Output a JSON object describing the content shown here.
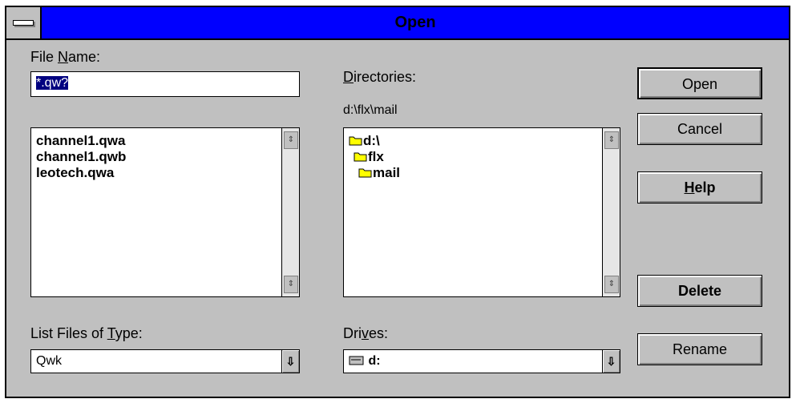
{
  "window": {
    "title": "Open"
  },
  "file_name": {
    "label_pre": "File ",
    "label_accel": "N",
    "label_post": "ame:",
    "value": "*.qw?",
    "files": [
      "channel1.qwa",
      "channel1.qwb",
      "leotech.qwa"
    ]
  },
  "directories": {
    "label_pre": "",
    "label_accel": "D",
    "label_post": "irectories:",
    "current_path": "d:\\flx\\mail",
    "items": [
      {
        "name": "d:\\",
        "icon": "open-folder-icon"
      },
      {
        "name": "flx",
        "icon": "open-folder-icon"
      },
      {
        "name": "mail",
        "icon": "open-folder-icon"
      }
    ]
  },
  "file_type": {
    "label_pre": "List Files of ",
    "label_accel": "T",
    "label_post": "ype:",
    "selected": "Qwk"
  },
  "drives": {
    "label_pre": "Dri",
    "label_accel": "v",
    "label_post": "es:",
    "selected": "d:",
    "icon": "drive-icon"
  },
  "buttons": {
    "open": "Open",
    "cancel": "Cancel",
    "help_accel": "H",
    "help_rest": "elp",
    "delete": "Delete",
    "rename": "Rename"
  },
  "colors": {
    "title_bar": "#0000ff",
    "dialog_face": "#c0c0c0",
    "folder": "#ffff00"
  }
}
